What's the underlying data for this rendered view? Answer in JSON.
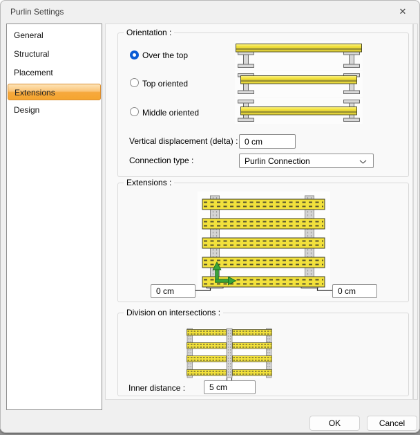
{
  "window": {
    "title": "Purlin Settings",
    "close_glyph": "✕"
  },
  "sidebar": {
    "items": [
      {
        "label": "General",
        "selected": false
      },
      {
        "label": "Structural",
        "selected": false
      },
      {
        "label": "Placement",
        "selected": false
      },
      {
        "label": "Extensions",
        "selected": true
      },
      {
        "label": "Design",
        "selected": false
      }
    ]
  },
  "orientation": {
    "group_label": "Orientation :",
    "options": [
      {
        "label": "Over the top",
        "selected": true
      },
      {
        "label": "Top oriented",
        "selected": false
      },
      {
        "label": "Middle oriented",
        "selected": false
      }
    ],
    "vertical_displacement": {
      "label": "Vertical displacement (delta) :",
      "value": "0 cm"
    },
    "connection_type": {
      "label": "Connection type :",
      "value": "Purlin Connection"
    }
  },
  "extensions": {
    "group_label": "Extensions :",
    "left_extension_value": "0 cm",
    "right_extension_value": "0 cm"
  },
  "division": {
    "group_label": "Division on intersections :",
    "inner_distance_label": "Inner distance :",
    "inner_distance_value": "5 cm"
  },
  "footer": {
    "ok_label": "OK",
    "cancel_label": "Cancel"
  },
  "colors": {
    "selection_orange": "#f5a52f",
    "selection_orange_border": "#d98e32",
    "radio_blue": "#0b5cd5",
    "purlin_yellow": "#f2e13c",
    "purlin_stripe_olive": "#9d9432",
    "column_gray": "#d4d4d4",
    "axis_green": "#3aa53a",
    "panel_bg": "#f9f9f9",
    "dialog_bg": "#f0f0f0"
  }
}
